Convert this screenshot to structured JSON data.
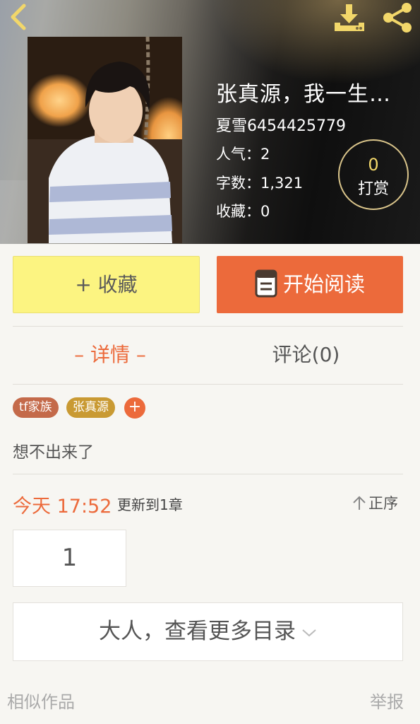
{
  "header": {
    "back_icon": "chevron-left-icon",
    "download_icon": "download-icon",
    "share_icon": "share-icon",
    "accent_color": "#f2d76a"
  },
  "book": {
    "title": "张真源，我一生…",
    "author": "夏雪6454425779",
    "popularity": "人气：2",
    "word_count": "字数：1,321",
    "favorites": "收藏：0",
    "reward_count": "0",
    "reward_label": "打赏"
  },
  "actions": {
    "favorite_label": "+ 收藏",
    "read_label": "开始阅读",
    "read_icon": "book-icon"
  },
  "tabs": {
    "details": "– 详情 –",
    "comments": "评论(0)"
  },
  "tags": [
    "tf家族",
    "张真源"
  ],
  "tag_add": "+",
  "description": "想不出来了",
  "updates": {
    "time": "今天 17:52",
    "text": "更新到1章",
    "sort_label": "正序"
  },
  "chapters": [
    "1"
  ],
  "more_label": "大人，查看更多目录",
  "footer": {
    "similar": "相似作品",
    "report": "举报"
  },
  "colors": {
    "orange": "#ec6a3b",
    "yellow": "#fcf481",
    "background": "#f7f6f2"
  }
}
